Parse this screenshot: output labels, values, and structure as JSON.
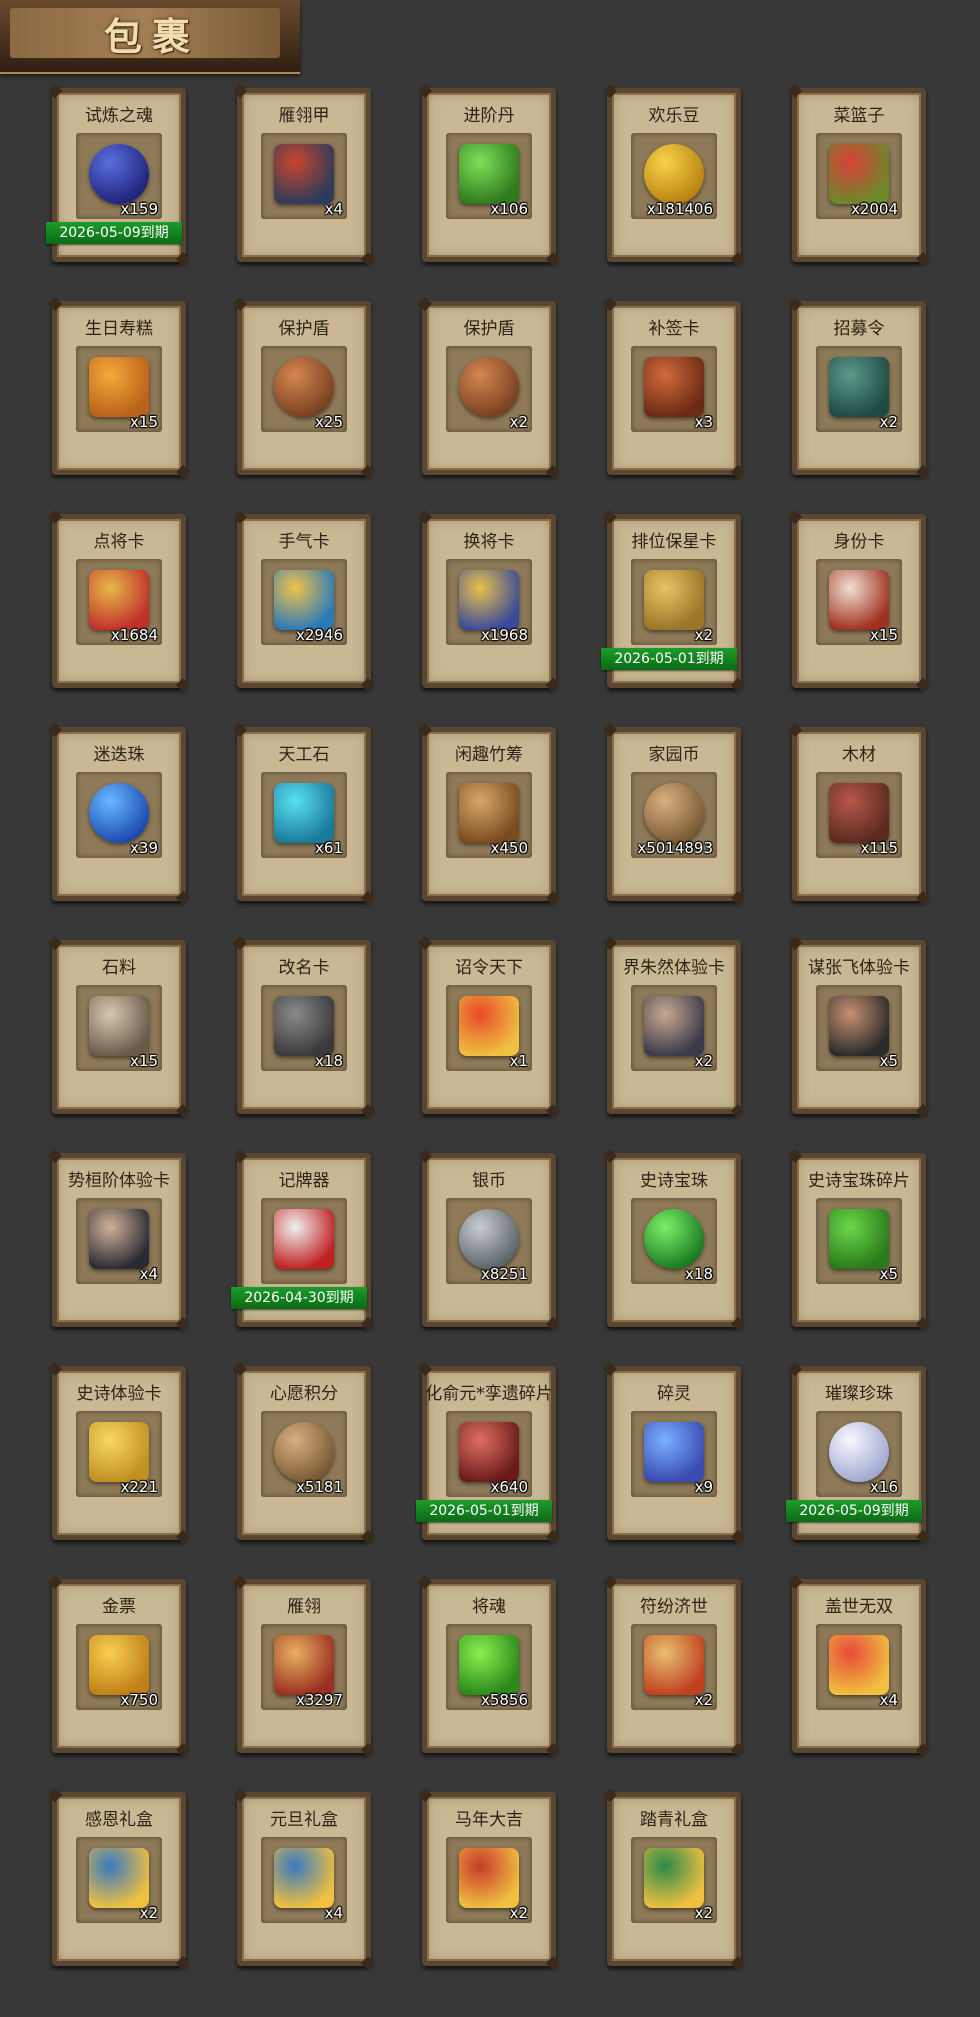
{
  "header": {
    "title": "包裹"
  },
  "items": [
    {
      "name": "试炼之魂",
      "qty": "x159",
      "expiry": "2026-05-09到期",
      "icon": "blue-dragon-orb-icon",
      "c1": "#5a6ee0",
      "c2": "#20237a"
    },
    {
      "name": "雁翎甲",
      "qty": "x4",
      "expiry": "",
      "icon": "armor-icon",
      "c1": "#c8462c",
      "c2": "#2d3b5c"
    },
    {
      "name": "进阶丹",
      "qty": "x106",
      "expiry": "",
      "icon": "green-pill-icon",
      "c1": "#7fe05a",
      "c2": "#2f7a1c"
    },
    {
      "name": "欢乐豆",
      "qty": "x181406",
      "expiry": "",
      "icon": "gold-beans-icon",
      "c1": "#f7d34a",
      "c2": "#b9820f"
    },
    {
      "name": "菜篮子",
      "qty": "x2004",
      "expiry": "",
      "icon": "vegetable-basket-icon",
      "c1": "#d84038",
      "c2": "#6b8a2a"
    },
    {
      "name": "生日寿糕",
      "qty": "x15",
      "expiry": "",
      "icon": "birthday-cake-icon",
      "c1": "#f6a83a",
      "c2": "#b8621a"
    },
    {
      "name": "保护盾",
      "qty": "x25",
      "expiry": "",
      "icon": "shield-icon",
      "c1": "#d48650",
      "c2": "#7a4020"
    },
    {
      "name": "保护盾",
      "qty": "x2",
      "expiry": "",
      "icon": "shield-icon",
      "c1": "#d48650",
      "c2": "#7a4020"
    },
    {
      "name": "补签卡",
      "qty": "x3",
      "expiry": "",
      "icon": "sign-card-icon",
      "c1": "#d06a3c",
      "c2": "#6b2a14"
    },
    {
      "name": "招募令",
      "qty": "x2",
      "expiry": "",
      "icon": "recruit-token-icon",
      "c1": "#5a9a8a",
      "c2": "#1f4a44"
    },
    {
      "name": "点将卡",
      "qty": "x1684",
      "expiry": "",
      "icon": "general-card-icon",
      "c1": "#e8b84a",
      "c2": "#c0302a"
    },
    {
      "name": "手气卡",
      "qty": "x2946",
      "expiry": "",
      "icon": "luck-card-icon",
      "c1": "#f0c24a",
      "c2": "#2a7ab8"
    },
    {
      "name": "换将卡",
      "qty": "x1968",
      "expiry": "",
      "icon": "swap-card-icon",
      "c1": "#e8c04a",
      "c2": "#3a4a9a"
    },
    {
      "name": "排位保星卡",
      "qty": "x2",
      "expiry": "2026-05-01到期",
      "icon": "rank-star-card-icon",
      "c1": "#e8c464",
      "c2": "#9a7428"
    },
    {
      "name": "身份卡",
      "qty": "x15",
      "expiry": "",
      "icon": "identity-card-icon",
      "c1": "#f0e0d0",
      "c2": "#a03020"
    },
    {
      "name": "迷迭珠",
      "qty": "x39",
      "expiry": "",
      "icon": "blue-orb-icon",
      "c1": "#6ab8ff",
      "c2": "#1a4ab0"
    },
    {
      "name": "天工石",
      "qty": "x61",
      "expiry": "",
      "icon": "crystal-stone-icon",
      "c1": "#5ae0f0",
      "c2": "#1a7a9a"
    },
    {
      "name": "闲趣竹筹",
      "qty": "x450",
      "expiry": "",
      "icon": "bamboo-tally-icon",
      "c1": "#d8a868",
      "c2": "#7a4a20"
    },
    {
      "name": "家园币",
      "qty": "x5014893",
      "expiry": "",
      "icon": "home-coin-icon",
      "c1": "#d8b080",
      "c2": "#7a5a34"
    },
    {
      "name": "木材",
      "qty": "x115",
      "expiry": "",
      "icon": "wood-icon",
      "c1": "#b8584a",
      "c2": "#5a2a20"
    },
    {
      "name": "石料",
      "qty": "x15",
      "expiry": "",
      "icon": "stone-icon",
      "c1": "#d8c8b0",
      "c2": "#6a5a4a"
    },
    {
      "name": "改名卡",
      "qty": "x18",
      "expiry": "",
      "icon": "rename-card-icon",
      "c1": "#8a8a8a",
      "c2": "#3a3a3a"
    },
    {
      "name": "诏令天下",
      "qty": "x1",
      "expiry": "",
      "icon": "edict-scroll-icon",
      "c1": "#e84a2a",
      "c2": "#f0c040"
    },
    {
      "name": "界朱然体验卡",
      "qty": "x2",
      "expiry": "",
      "icon": "hero-portrait-icon",
      "c1": "#c8a890",
      "c2": "#3a3a4a"
    },
    {
      "name": "谋张飞体验卡",
      "qty": "x5",
      "expiry": "",
      "icon": "hero-portrait-icon",
      "c1": "#c89070",
      "c2": "#2a2a2a"
    },
    {
      "name": "势桓阶体验卡",
      "qty": "x4",
      "expiry": "",
      "icon": "hero-portrait-icon",
      "c1": "#d0b098",
      "c2": "#2a2a34"
    },
    {
      "name": "记牌器",
      "qty": "",
      "expiry": "2026-04-30到期",
      "icon": "card-counter-icon",
      "c1": "#f0f0f0",
      "c2": "#c02020"
    },
    {
      "name": "银币",
      "qty": "x8251",
      "expiry": "",
      "icon": "silver-coin-icon",
      "c1": "#c8ccd0",
      "c2": "#5a646a"
    },
    {
      "name": "史诗宝珠",
      "qty": "x18",
      "expiry": "",
      "icon": "green-orb-icon",
      "c1": "#7af06a",
      "c2": "#1a7a20"
    },
    {
      "name": "史诗宝珠碎片",
      "qty": "x5",
      "expiry": "",
      "icon": "green-leaf-shard-icon",
      "c1": "#6ad84a",
      "c2": "#2a7a1a"
    },
    {
      "name": "史诗体验卡",
      "qty": "x221",
      "expiry": "",
      "icon": "gold-card-icon",
      "c1": "#f8d860",
      "c2": "#c09020"
    },
    {
      "name": "心愿积分",
      "qty": "x5181",
      "expiry": "",
      "icon": "heart-coin-icon",
      "c1": "#d8b080",
      "c2": "#7a5a34"
    },
    {
      "name": "化俞元*孪遗碎片",
      "qty": "x640",
      "expiry": "2026-05-01到期",
      "icon": "hero-portrait-icon",
      "c1": "#e07060",
      "c2": "#6a1a1a"
    },
    {
      "name": "碎灵",
      "qty": "x9",
      "expiry": "",
      "icon": "spirit-crystal-icon",
      "c1": "#7ab0ff",
      "c2": "#3a4ab0"
    },
    {
      "name": "璀璨珍珠",
      "qty": "x16",
      "expiry": "2026-05-09到期",
      "icon": "pearl-icon",
      "c1": "#f8f8ff",
      "c2": "#a0a8d0"
    },
    {
      "name": "金票",
      "qty": "x750",
      "expiry": "",
      "icon": "gold-ticket-icon",
      "c1": "#f8d050",
      "c2": "#c08018"
    },
    {
      "name": "雁翎",
      "qty": "x3297",
      "expiry": "",
      "icon": "feather-icon",
      "c1": "#e8b060",
      "c2": "#9a3020"
    },
    {
      "name": "将魂",
      "qty": "x5856",
      "expiry": "",
      "icon": "green-soul-crystal-icon",
      "c1": "#8af050",
      "c2": "#2a8a1a"
    },
    {
      "name": "符纷济世",
      "qty": "x2",
      "expiry": "",
      "icon": "gift-box-icon",
      "c1": "#e8c070",
      "c2": "#c04020"
    },
    {
      "name": "盖世无双",
      "qty": "x4",
      "expiry": "",
      "icon": "gift-box-icon",
      "c1": "#e84a3a",
      "c2": "#f0c040"
    },
    {
      "name": "感恩礼盒",
      "qty": "x2",
      "expiry": "",
      "icon": "gift-box-icon",
      "c1": "#3a7ac0",
      "c2": "#f0c040"
    },
    {
      "name": "元旦礼盒",
      "qty": "x4",
      "expiry": "",
      "icon": "gift-box-icon",
      "c1": "#3a7ac0",
      "c2": "#f0c040"
    },
    {
      "name": "马年大吉",
      "qty": "x2",
      "expiry": "",
      "icon": "gift-box-icon",
      "c1": "#c83a2a",
      "c2": "#f0c040"
    },
    {
      "name": "踏青礼盒",
      "qty": "x2",
      "expiry": "",
      "icon": "gift-box-icon",
      "c1": "#2a8a4a",
      "c2": "#f0c040"
    }
  ]
}
